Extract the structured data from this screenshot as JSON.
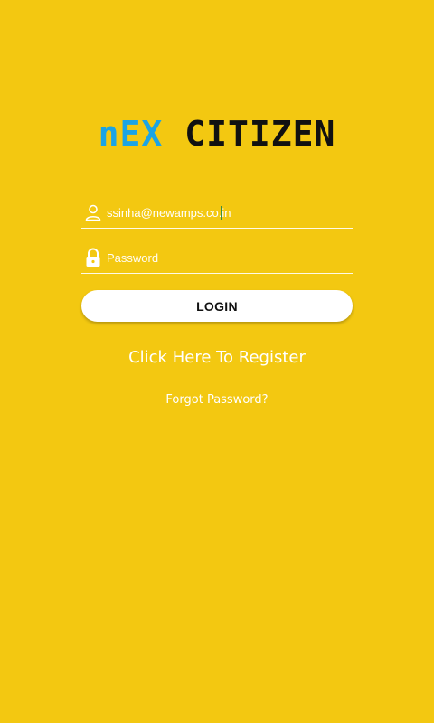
{
  "app": {
    "logo_part1": "nEX",
    "logo_part2": "CITIZEN"
  },
  "form": {
    "email": {
      "value": "ssinha@newamps.co.in",
      "icon": "person-icon"
    },
    "password": {
      "placeholder": "Password",
      "icon": "lock-icon"
    },
    "login_label": "LOGIN"
  },
  "links": {
    "register": "Click Here To Register",
    "forgot": "Forgot Password?"
  },
  "colors": {
    "background": "#F3C811",
    "logo_accent": "#1BA4E4",
    "logo_dark": "#111111"
  }
}
